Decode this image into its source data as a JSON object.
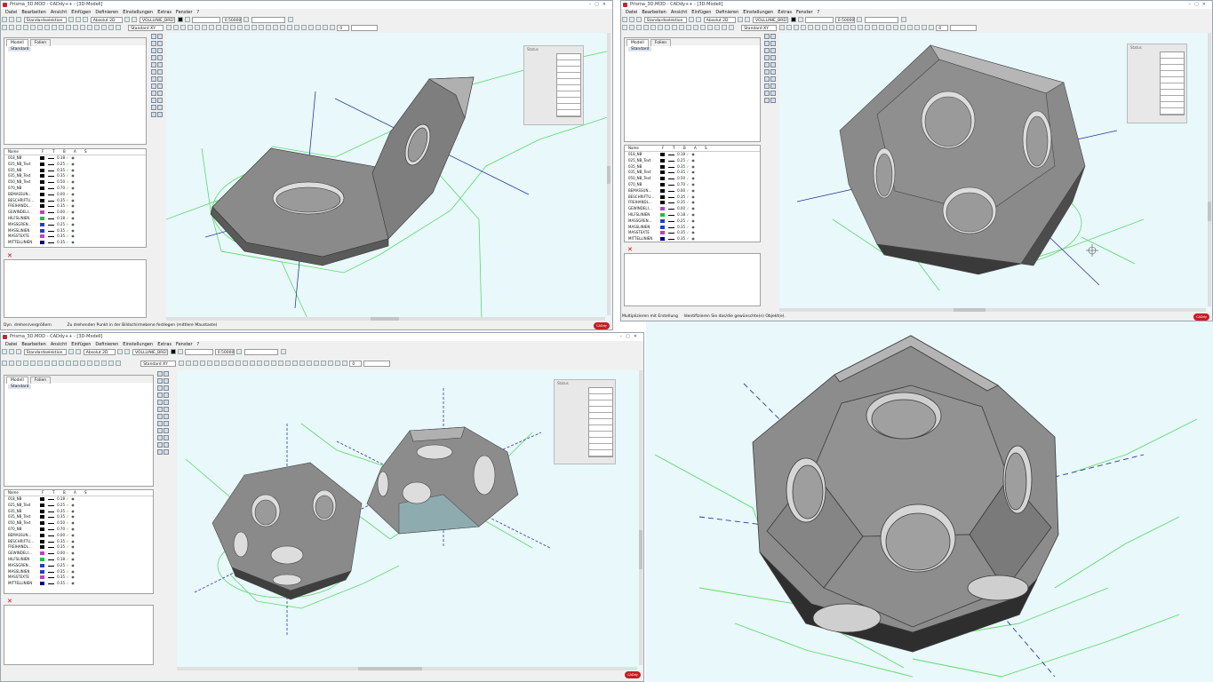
{
  "colors": {
    "viewport_bg": "#e8f8fb",
    "solid": "#8c8c8c",
    "edge_green": "#5fd96a",
    "axis_blue": "#2b3a9a",
    "brand": "#c41e23"
  },
  "windows": [
    {
      "title": "Prisma_3D.MOD - CADdy++ - [3D-Modell]",
      "menu": [
        "Datei",
        "Bearbeiten",
        "Ansicht",
        "Einfügen",
        "Definieren",
        "Einstellungen",
        "Extras",
        "Fenster",
        "?"
      ],
      "selection_combo": "Standardselektion",
      "coord_combo": "Absolut 2D",
      "linetype_combo": "VOLLLINIE_BREIT",
      "value_field": "0.500000",
      "view_combo": "Standard XY",
      "page_field": "0",
      "tabs": [
        "Modell",
        "Folien"
      ],
      "tree_item": "Standard",
      "status_label": "Status",
      "status_left": "Dyn. drehen/vergrößern",
      "status_right": "Zu drehenden Punkt in der Bildschirmebene festlegen (mittlere Maustaste)",
      "logo": "CADdy"
    },
    {
      "title": "Prisma_3D.MOD - CADdy++ - [3D-Modell]",
      "menu": [
        "Datei",
        "Bearbeiten",
        "Ansicht",
        "Einfügen",
        "Definieren",
        "Einstellungen",
        "Extras",
        "Fenster",
        "?"
      ],
      "selection_combo": "Standardselektion",
      "coord_combo": "Absolut 2D",
      "linetype_combo": "VOLLLINIE_BREIT",
      "value_field": "0.500000",
      "view_combo": "Standard XY",
      "page_field": "0",
      "tabs": [
        "Modell",
        "Folien"
      ],
      "tree_item": "Standard",
      "status_label": "Status",
      "status_left": "Multiplizieren mit Erstellung",
      "status_right": "Identifizieren Sie das/die gewünschte(n) Objekt(e).",
      "logo": "CADdy"
    },
    {
      "title": "Prisma_3D.MOD - CADdy++ - [3D-Modell]",
      "menu": [
        "Datei",
        "Bearbeiten",
        "Ansicht",
        "Einfügen",
        "Definieren",
        "Einstellungen",
        "Extras",
        "Fenster",
        "?"
      ],
      "selection_combo": "Standardselektion",
      "coord_combo": "Absolut 2D",
      "linetype_combo": "VOLLLINIE_BREIT",
      "value_field": "0.500000",
      "view_combo": "Standard XY",
      "page_field": "0",
      "tabs": [
        "Modell",
        "Folien"
      ],
      "tree_item": "Standard",
      "status_label": "Status",
      "status_left": "",
      "status_right": "",
      "logo": "CADdy"
    }
  ],
  "layer_headers": [
    "Name",
    "F",
    "T",
    "B",
    "A",
    "S"
  ],
  "layers": [
    {
      "name": "018_NB",
      "color": "#000000",
      "width": "0.18"
    },
    {
      "name": "025_NB_Text",
      "color": "#000000",
      "width": "0.25"
    },
    {
      "name": "035_NB",
      "color": "#000000",
      "width": "0.35"
    },
    {
      "name": "035_NB_Text",
      "color": "#000000",
      "width": "0.35"
    },
    {
      "name": "050_NB_Text",
      "color": "#000000",
      "width": "0.50"
    },
    {
      "name": "070_NB",
      "color": "#000000",
      "width": "0.70"
    },
    {
      "name": "BEMASSUN...",
      "color": "#000000",
      "width": "0.00"
    },
    {
      "name": "BESCHRIFTU...",
      "color": "#000000",
      "width": "0.35"
    },
    {
      "name": "FREIHANDL...",
      "color": "#000000",
      "width": "0.35"
    },
    {
      "name": "GEWINDELI...",
      "color": "#c040c0",
      "width": "0.00"
    },
    {
      "name": "HILFSLINIEN",
      "color": "#20c040",
      "width": "0.18"
    },
    {
      "name": "MASSGREN...",
      "color": "#2040c0",
      "width": "0.25"
    },
    {
      "name": "MASSLINIEN",
      "color": "#2040c0",
      "width": "0.35"
    },
    {
      "name": "MASSTEXTE",
      "color": "#c040c0",
      "width": "0.35"
    },
    {
      "name": "MITTELLINIEN",
      "color": "#000080",
      "width": "0.35"
    }
  ]
}
